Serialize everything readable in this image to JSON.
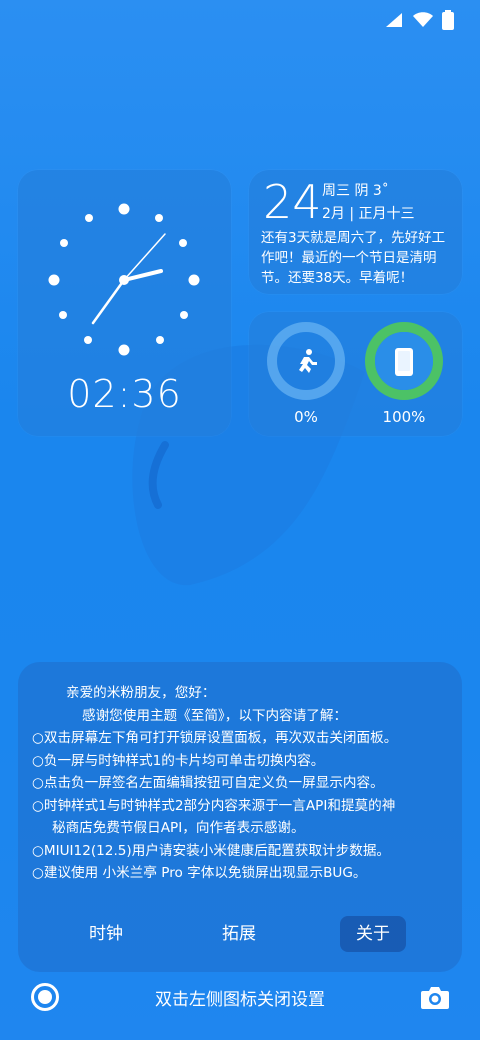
{
  "status_bar": {
    "icons": [
      "signal-icon",
      "wifi-icon",
      "battery-icon"
    ]
  },
  "clock_widget": {
    "digital_time": "02:36"
  },
  "date_widget": {
    "day": "24",
    "weekday_weather": "周三 阴 3˚",
    "month_lunar": "2月 | 正月十三",
    "message": "还有3天就是周六了，先好好工作吧！最近的一个节日是清明节。还要38天。早着呢！"
  },
  "stats_widget": {
    "steps_percent": "0%",
    "battery_percent": "100%",
    "steps_progress": 0,
    "battery_progress": 1.0,
    "colors": {
      "steps_ring": "#5aaaf0",
      "battery_ring": "#4cc266",
      "battery_inner": "#2a8ee8"
    }
  },
  "settings_panel": {
    "lines": [
      "亲爱的米粉朋友，您好：",
      "感谢您使用主题《至简》，以下内容请了解：",
      "○双击屏幕左下角可打开锁屏设置面板，再次双击关闭面板。",
      "○负一屏与时钟样式1的卡片均可单击切换内容。",
      "○点击负一屏签名左面编辑按钮可自定义负一屏显示内容。",
      "○时钟样式1与时钟样式2部分内容来源于一言API和提莫的神",
      "秘商店免费节假日API，向作者表示感谢。",
      "○MIUI12(12.5)用户请安装小米健康后配置获取计步数据。",
      "○建议使用 小米兰亭 Pro 字体以免锁屏出现显示BUG。"
    ],
    "tabs": {
      "clock": "时钟",
      "extend": "拓展",
      "about": "关于"
    },
    "active_tab": "about"
  },
  "bottom_bar": {
    "hint": "双击左侧图标关闭设置",
    "left_icon": "record-icon",
    "right_icon": "camera-icon"
  }
}
